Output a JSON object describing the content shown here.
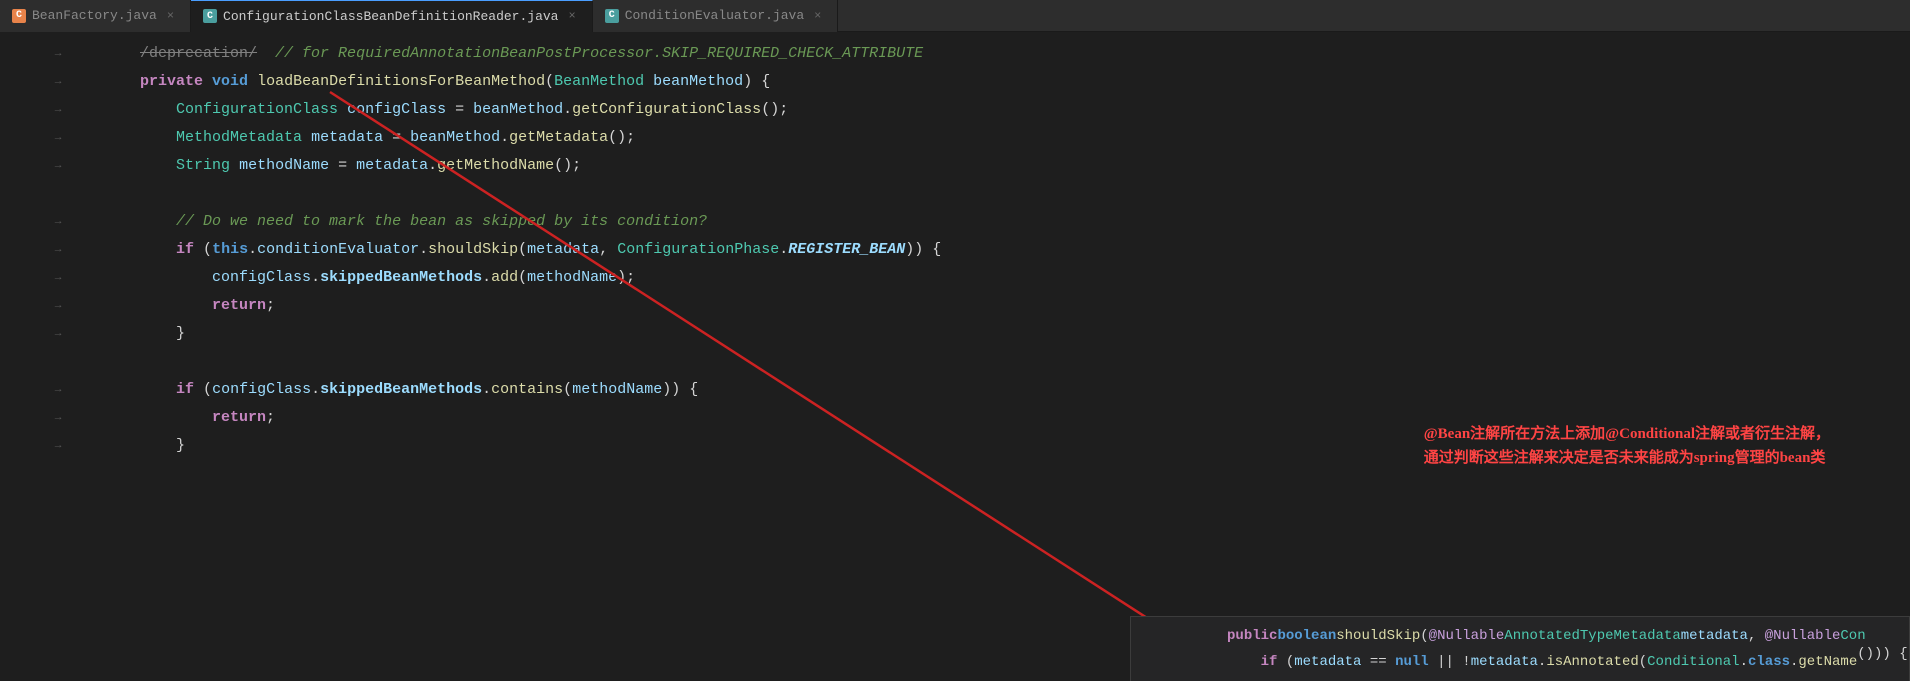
{
  "tabs": [
    {
      "id": "tab1",
      "label": "BeanFactory.java",
      "icon": "orange",
      "active": false,
      "closeable": true
    },
    {
      "id": "tab2",
      "label": "ConfigurationClassBeanDefinitionReader.java",
      "icon": "teal",
      "active": true,
      "closeable": true
    },
    {
      "id": "tab3",
      "label": "ConditionEvaluator.java",
      "icon": "teal",
      "active": false,
      "closeable": true
    }
  ],
  "code": {
    "lines": [
      {
        "gutter": "",
        "arrow": "→",
        "text": "/deprecation/  // for RequiredAnnotationBeanPostProcessor.SKIP_REQUIRED_CHECK_ATTRIBUTE",
        "style": "comment"
      },
      {
        "gutter": "",
        "arrow": "→",
        "text": "private void loadBeanDefinitionsForBeanMethod(BeanMethod beanMethod) {",
        "style": "method-decl"
      },
      {
        "gutter": "",
        "arrow": "→",
        "text": "    ConfigurationClass configClass = beanMethod.getConfigurationClass();",
        "style": "normal"
      },
      {
        "gutter": "",
        "arrow": "→",
        "text": "    MethodMetadata metadata = beanMethod.getMetadata();",
        "style": "normal"
      },
      {
        "gutter": "",
        "arrow": "→",
        "text": "    String methodName = metadata.getMethodName();",
        "style": "normal"
      },
      {
        "gutter": "",
        "arrow": "",
        "text": "",
        "style": "normal"
      },
      {
        "gutter": "",
        "arrow": "→",
        "text": "    // Do we need to mark the bean as skipped by its condition?",
        "style": "comment"
      },
      {
        "gutter": "",
        "arrow": "→",
        "text": "    if (this.conditionEvaluator.shouldSkip(metadata, ConfigurationPhase.REGISTER_BEAN)) {",
        "style": "if-line"
      },
      {
        "gutter": "",
        "arrow": "→",
        "text": "        configClass.skippedBeanMethods.add(methodName);",
        "style": "normal"
      },
      {
        "gutter": "",
        "arrow": "→",
        "text": "        return;",
        "style": "return"
      },
      {
        "gutter": "",
        "arrow": "→",
        "text": "    }",
        "style": "normal"
      },
      {
        "gutter": "",
        "arrow": "",
        "text": "",
        "style": "normal"
      },
      {
        "gutter": "",
        "arrow": "→",
        "text": "    if (configClass.skippedBeanMethods.contains(methodName)) {",
        "style": "if2-line"
      },
      {
        "gutter": "",
        "arrow": "→",
        "text": "        return;",
        "style": "return"
      },
      {
        "gutter": "",
        "arrow": "→",
        "text": "    }",
        "style": "normal"
      }
    ]
  },
  "annotation": {
    "line1": "@Bean注解所在方法上添加@Conditional注解或者衍生注解，",
    "line2": "通过判断这些注解来决定是否未来能成为spring管理的bean类"
  },
  "popup": {
    "line1": "    public boolean shouldSkip(@Nullable AnnotatedTypeMetadata metadata, @Nullable Con",
    "line2": "        if (metadata == null || !metadata.isAnnotated(Conditional.class.getName())) {"
  },
  "colors": {
    "keyword_blue": "#569cd6",
    "keyword_purple": "#c586c0",
    "type_green": "#4ec9b0",
    "method_yellow": "#dcdcaa",
    "field_blue": "#9cdcfe",
    "comment_green": "#6a9955",
    "italic_field": "#9cdcfe",
    "red_annotation": "#ff4444",
    "accent_tab": "#4a9eff"
  }
}
